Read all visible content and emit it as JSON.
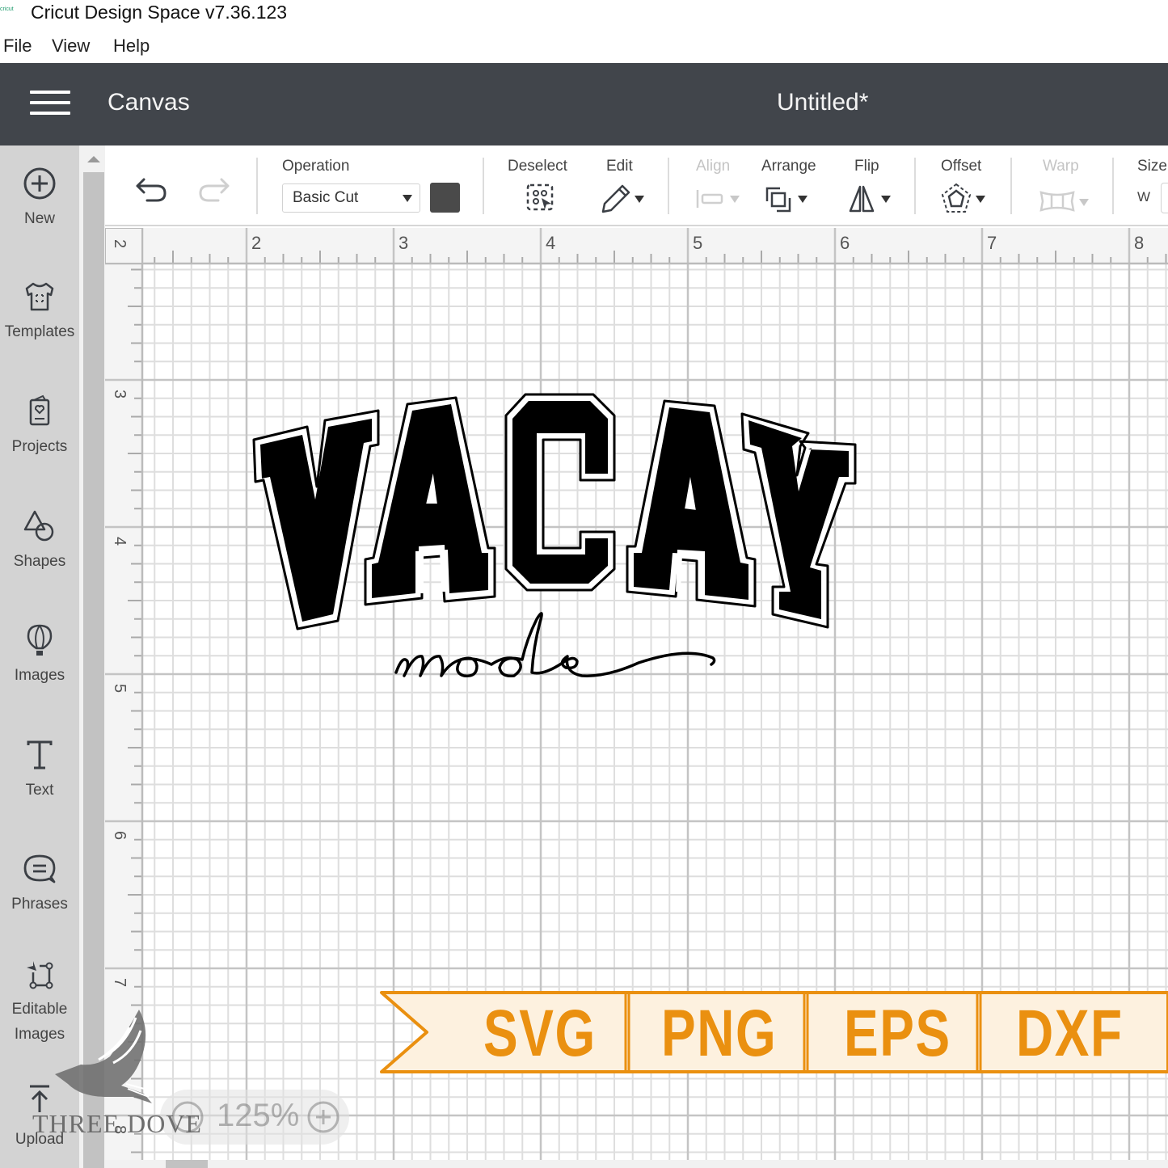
{
  "window": {
    "logo_text": "cricut",
    "title": "Cricut Design Space  v7.36.123"
  },
  "menu": [
    "File",
    "View",
    "Help"
  ],
  "header": {
    "section": "Canvas",
    "document_title": "Untitled*"
  },
  "sidebar": {
    "items": [
      {
        "label": "New",
        "icon": "plus-circle-icon"
      },
      {
        "label": "Templates",
        "icon": "tshirt-icon"
      },
      {
        "label": "Projects",
        "icon": "card-heart-icon"
      },
      {
        "label": "Shapes",
        "icon": "shapes-icon"
      },
      {
        "label": "Images",
        "icon": "balloon-icon"
      },
      {
        "label": "Text",
        "icon": "text-t-icon"
      },
      {
        "label": "Phrases",
        "icon": "speech-bubble-icon"
      },
      {
        "label": "Editable",
        "label2": "Images",
        "icon": "editable-images-icon"
      },
      {
        "label": "Upload",
        "icon": "upload-icon"
      }
    ]
  },
  "toolbar": {
    "undo": "undo-icon",
    "redo": "redo-icon",
    "operation_label": "Operation",
    "operation_value": "Basic Cut",
    "operation_color": "#4a4a4a",
    "deselect_label": "Deselect",
    "edit_label": "Edit",
    "align_label": "Align",
    "align_enabled": false,
    "arrange_label": "Arrange",
    "flip_label": "Flip",
    "offset_label": "Offset",
    "warp_label": "Warp",
    "warp_enabled": false,
    "size_label": "Size",
    "size_w_label": "W"
  },
  "rulers": {
    "horizontal": [
      "2",
      "3",
      "4",
      "5",
      "6",
      "7",
      "8"
    ],
    "vertical": [
      "2",
      "3",
      "4",
      "5",
      "6",
      "7",
      "8"
    ],
    "units": "inches"
  },
  "canvas_design": {
    "main_text": "VACAY",
    "sub_text": "mode",
    "fill": "#000000"
  },
  "zoom": {
    "value": "125%",
    "minus": "zoom-out-icon",
    "plus": "zoom-in-icon"
  },
  "banner": {
    "formats": [
      "SVG",
      "PNG",
      "EPS",
      "DXF"
    ],
    "color": "#ea9010",
    "background": "#fdf1df"
  },
  "watermark": {
    "text": "THREE DOVE"
  }
}
